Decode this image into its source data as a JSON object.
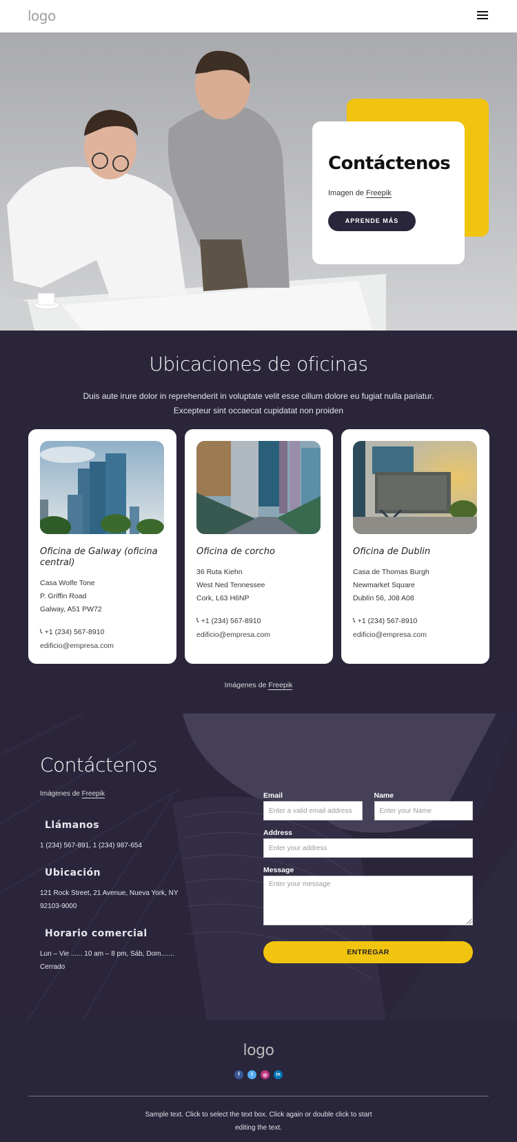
{
  "header": {
    "logo": "logo",
    "menu_icon": "hamburger-menu-icon"
  },
  "hero": {
    "title": "Contáctenos",
    "credit_prefix": "Imagen de ",
    "credit_link": "Freepik",
    "button_label": "APRENDE MÁS",
    "accent_color": "#f1c40f"
  },
  "offices": {
    "title": "Ubicaciones de oficinas",
    "subtitle": "Duis aute irure dolor in reprehenderit in voluptate velit esse cillum dolore eu fugiat nulla pariatur. Excepteur sint occaecat cupidatat non proiden",
    "cards": [
      {
        "name": "Oficina de Galway (oficina central)",
        "address": [
          "Casa Wolfe Tone",
          "P. Griffin Road",
          "Galway, A51 PW72"
        ],
        "phone": "+1 (234) 567-8910",
        "email": "edificio@empresa.com",
        "image": "glass-skyscrapers-photo"
      },
      {
        "name": "Oficina de corcho",
        "address": [
          "36 Ruta Kiehn",
          "West Ned Tennessee",
          "Cork, L63 H6NP"
        ],
        "phone": "+1 (234) 567-8910",
        "email": "edificio@empresa.com",
        "image": "glass-walkway-photo"
      },
      {
        "name": "Oficina de Dublin",
        "address": [
          "Casa de Thomas Burgh",
          "Newmarket Square",
          "Dublín 56, J08 A08"
        ],
        "phone": "+1 (234) 567-8910",
        "email": "edificio@empresa.com",
        "image": "modern-building-sunset-photo"
      }
    ],
    "credit_prefix": "Imágenes de ",
    "credit_link": "Freepik"
  },
  "contact": {
    "title": "Contáctenos",
    "credit_prefix": "Imágenes de ",
    "credit_link": "Freepik",
    "call_heading": "Llámanos",
    "call_text": "1 (234) 567-891, 1 (234) 987-654",
    "location_heading": "Ubicación",
    "location_text": "121 Rock Street, 21 Avenue, Nueva York, NY 92103-9000",
    "hours_heading": "Horario comercial",
    "hours_text": "Lun – Vie ...... 10 am – 8 pm, Sáb, Dom....... Cerrado",
    "form": {
      "email_label": "Email",
      "email_placeholder": "Enter a valid email address",
      "name_label": "Name",
      "name_placeholder": "Enter your Name",
      "address_label": "Address",
      "address_placeholder": "Enter your address",
      "message_label": "Message",
      "message_placeholder": "Enter your message",
      "submit_label": "ENTREGAR"
    }
  },
  "footer": {
    "logo": "logo",
    "socials": [
      {
        "name": "facebook",
        "glyph": "f",
        "color": "#3b5998"
      },
      {
        "name": "twitter",
        "glyph": "t",
        "color": "#55acee"
      },
      {
        "name": "instagram",
        "glyph": "◎",
        "color": "#c13584"
      },
      {
        "name": "linkedin",
        "glyph": "in",
        "color": "#0077b5"
      }
    ],
    "text": "Sample text. Click to select the text box. Click again or double click to start editing the text."
  }
}
